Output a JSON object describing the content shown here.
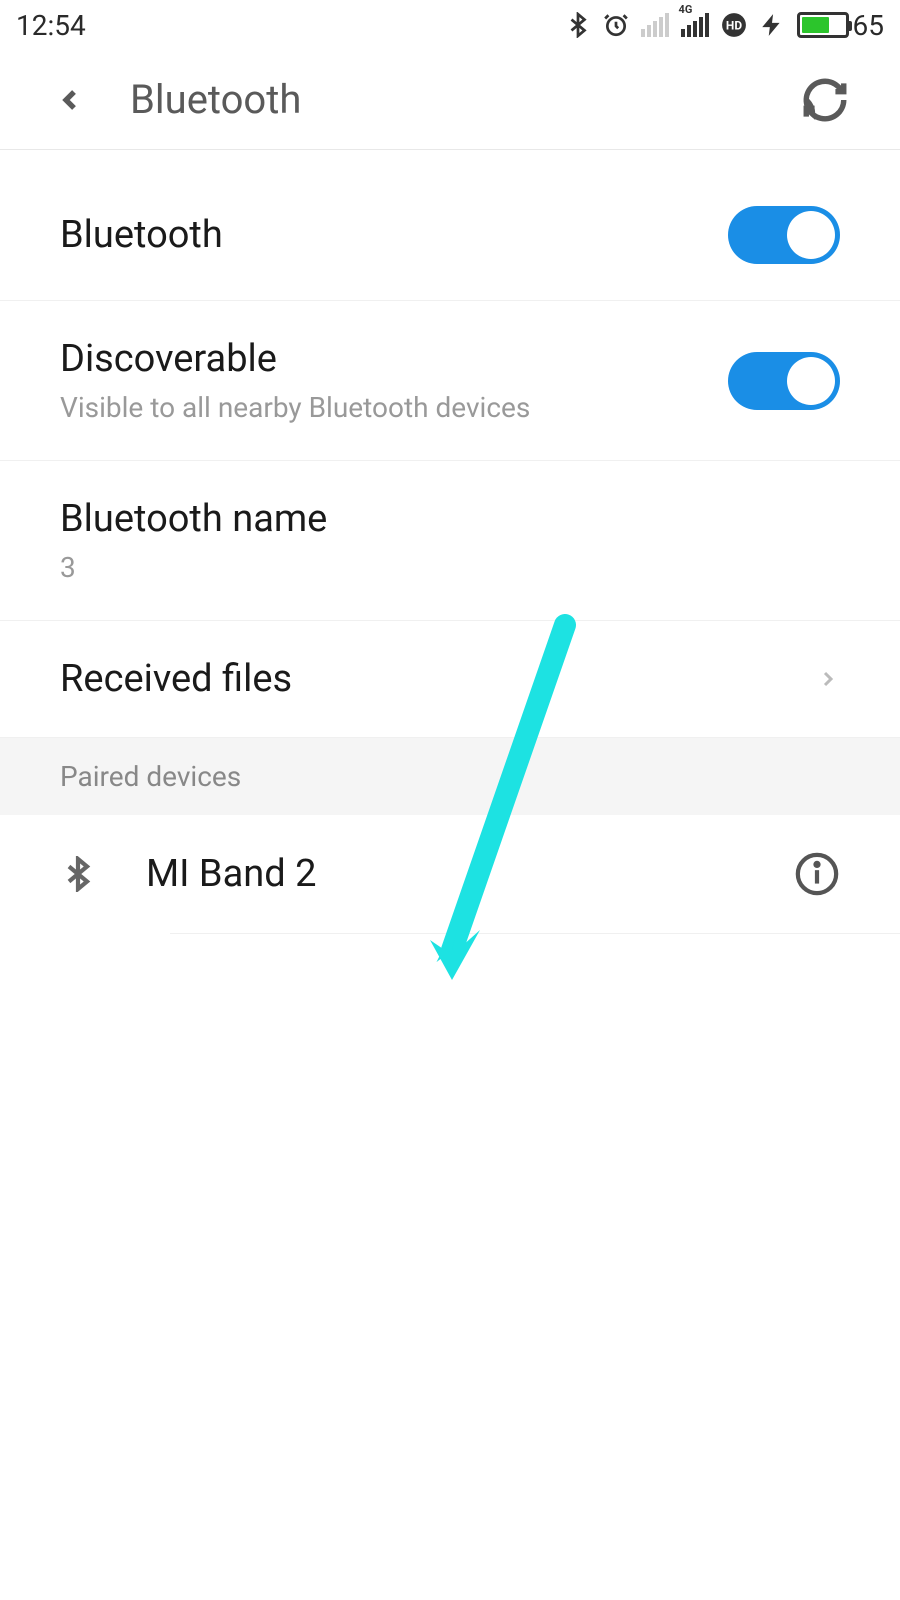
{
  "statusBar": {
    "time": "12:54",
    "battery": "65"
  },
  "header": {
    "title": "Bluetooth"
  },
  "settings": {
    "bluetoothToggle": {
      "label": "Bluetooth"
    },
    "discoverable": {
      "label": "Discoverable",
      "sublabel": "Visible to all nearby Bluetooth devices"
    },
    "bluetoothName": {
      "label": "Bluetooth name",
      "value": "3"
    },
    "receivedFiles": {
      "label": "Received files"
    }
  },
  "sections": {
    "pairedDevices": "Paired devices"
  },
  "devices": [
    {
      "name": "MI Band 2"
    }
  ]
}
